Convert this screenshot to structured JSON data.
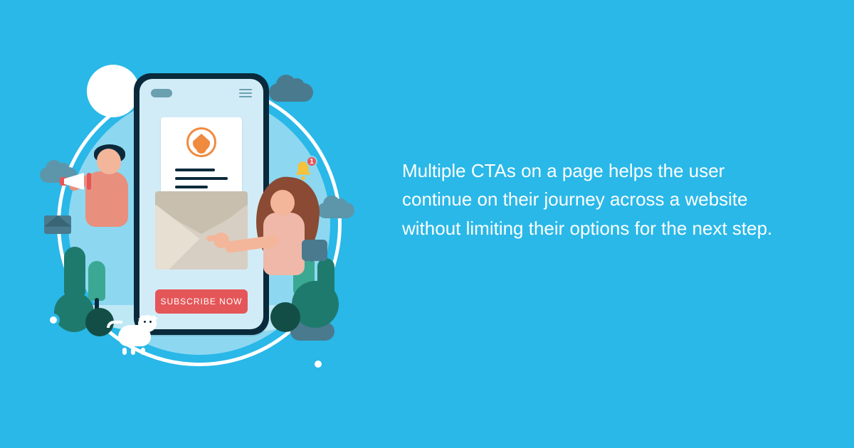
{
  "description": "Multiple CTAs on a page helps the user continue on their journey across a website without limiting their options for the next step.",
  "illustration": {
    "subscribe_label": "SUBSCRIBE NOW",
    "notification_count": "1"
  }
}
